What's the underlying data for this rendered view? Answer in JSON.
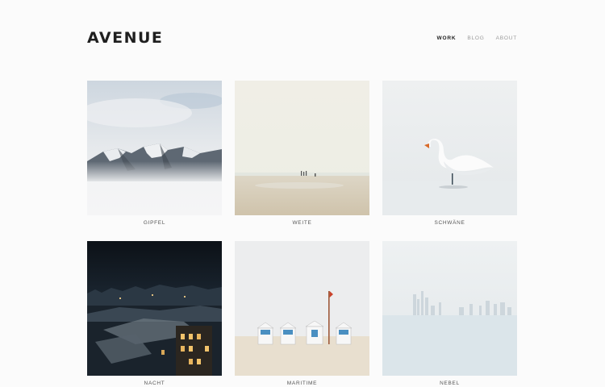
{
  "brand": {
    "logo": "AVENUE"
  },
  "nav": {
    "items": [
      {
        "label": "WORK",
        "active": true
      },
      {
        "label": "BLOG",
        "active": false
      },
      {
        "label": "ABOUT",
        "active": false
      }
    ]
  },
  "gallery": {
    "items": [
      {
        "caption": "GIPFEL",
        "image": "mountain-photo"
      },
      {
        "caption": "WEITE",
        "image": "beach-photo"
      },
      {
        "caption": "SCHWÄNE",
        "image": "swan-photo"
      },
      {
        "caption": "NACHT",
        "image": "night-city-photo"
      },
      {
        "caption": "MARITIME",
        "image": "beach-huts-photo"
      },
      {
        "caption": "NEBEL",
        "image": "fog-skyline-photo"
      }
    ]
  }
}
